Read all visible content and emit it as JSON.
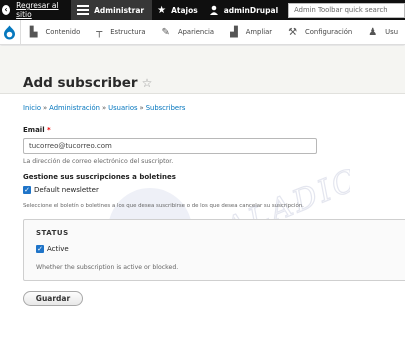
{
  "toolbar": {
    "back_label": "Regresar al sitio",
    "admin_label": "Administrar",
    "shortcuts_label": "Atajos",
    "user_label": "adminDrupal",
    "search_placeholder": "Admin Toolbar quick search"
  },
  "tray": {
    "items": [
      {
        "label": "Contenido",
        "icon": "document-icon"
      },
      {
        "label": "Estructura",
        "icon": "sitemap-icon"
      },
      {
        "label": "Apariencia",
        "icon": "paintbrush-icon"
      },
      {
        "label": "Ampliar",
        "icon": "puzzle-icon"
      },
      {
        "label": "Configuración",
        "icon": "wrench-icon"
      },
      {
        "label": "Usu",
        "icon": "people-icon"
      }
    ]
  },
  "page": {
    "title": "Add subscriber",
    "breadcrumb": [
      "Inicio",
      "Administración",
      "Usuarios",
      "Subscribers"
    ]
  },
  "form": {
    "email_label": "Email",
    "email_value": "tucorreo@tucorreo.com",
    "email_desc": "La dirección de correo electrónico del suscriptor.",
    "subs_heading": "Gestione sus suscripciones a boletines",
    "newsletter_label": "Default newsletter",
    "subs_desc": "Seleccione el boletín o boletines a los que desea suscribirse o de los que desea cancelar su suscripción.",
    "status_title": "STATUS",
    "active_label": "Active",
    "active_desc": "Whether the subscription is active or blocked.",
    "save_label": "Guardar"
  },
  "watermark": "DRUPALADICTO"
}
